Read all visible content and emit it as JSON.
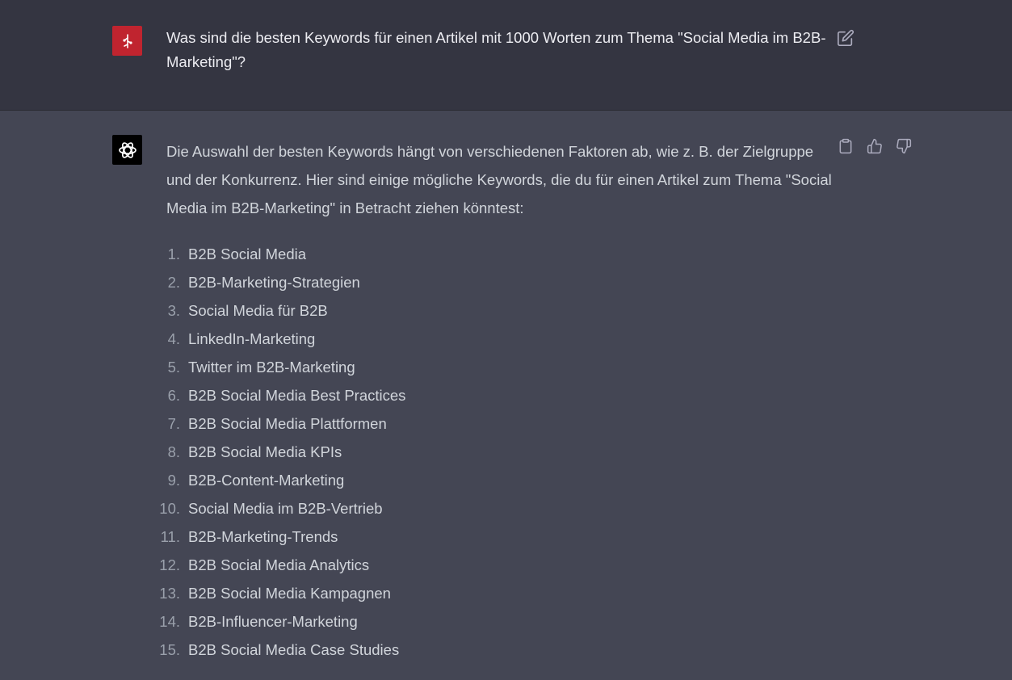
{
  "user_message": {
    "text": "Was sind die besten Keywords für einen Artikel mit 1000 Worten zum Thema \"Social Media im B2B-Marketing\"?",
    "avatar_icon": "user-avatar-icon",
    "avatar_color": "#c0242f"
  },
  "assistant_message": {
    "intro": "Die Auswahl der besten Keywords hängt von verschiedenen Faktoren ab, wie z. B. der Zielgruppe und der Konkurrenz. Hier sind einige mögliche Keywords, die du für einen Artikel zum Thema \"Social Media im B2B-Marketing\" in Betracht ziehen könntest:",
    "keywords": [
      {
        "num": "1.",
        "text": "B2B Social Media"
      },
      {
        "num": "2.",
        "text": "B2B-Marketing-Strategien"
      },
      {
        "num": "3.",
        "text": "Social Media für B2B"
      },
      {
        "num": "4.",
        "text": "LinkedIn-Marketing"
      },
      {
        "num": "5.",
        "text": "Twitter im B2B-Marketing"
      },
      {
        "num": "6.",
        "text": "B2B Social Media Best Practices"
      },
      {
        "num": "7.",
        "text": "B2B Social Media Plattformen"
      },
      {
        "num": "8.",
        "text": "B2B Social Media KPIs"
      },
      {
        "num": "9.",
        "text": "B2B-Content-Marketing"
      },
      {
        "num": "10.",
        "text": "Social Media im B2B-Vertrieb"
      },
      {
        "num": "11.",
        "text": "B2B-Marketing-Trends"
      },
      {
        "num": "12.",
        "text": "B2B Social Media Analytics"
      },
      {
        "num": "13.",
        "text": "B2B Social Media Kampagnen"
      },
      {
        "num": "14.",
        "text": "B2B-Influencer-Marketing"
      },
      {
        "num": "15.",
        "text": "B2B Social Media Case Studies"
      }
    ],
    "avatar_icon": "openai-logo-icon",
    "actions": [
      "clipboard-icon",
      "thumbs-up-icon",
      "thumbs-down-icon"
    ]
  },
  "colors": {
    "user_bg": "#343541",
    "assistant_bg": "#444654",
    "text": "#d1d5db",
    "icon": "#acacbe"
  }
}
